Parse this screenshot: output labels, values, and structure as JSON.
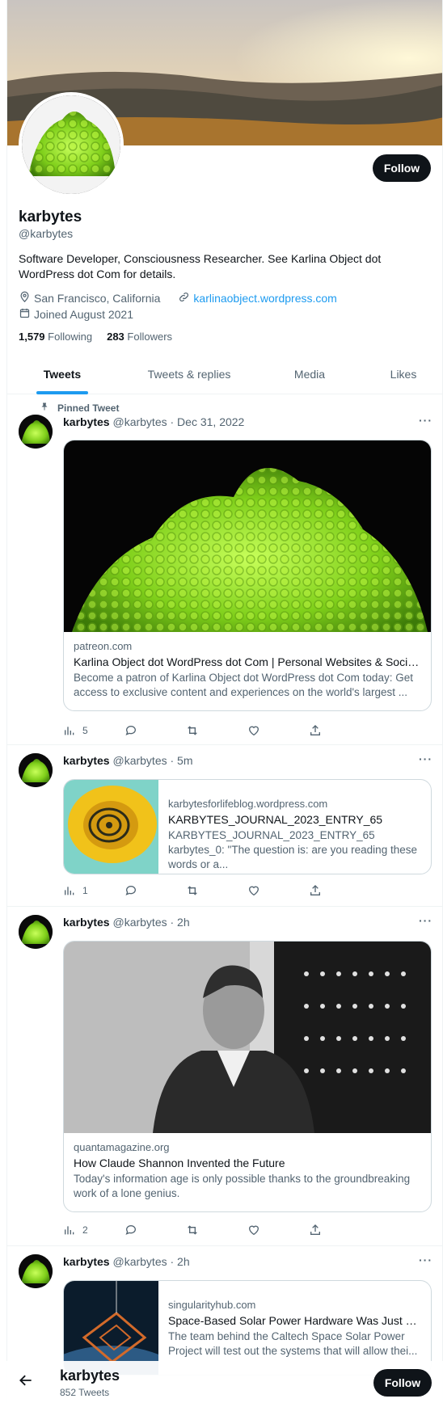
{
  "profile": {
    "name": "karbytes",
    "handle": "@karbytes",
    "follow_label": "Follow",
    "bio": "Software Developer, Consciousness Researcher. See Karlina Object dot WordPress dot Com for details.",
    "location": "San Francisco, California",
    "website": "karlinaobject.wordpress.com",
    "joined": "Joined August 2021",
    "following_count": "1,579",
    "following_label": "Following",
    "followers_count": "283",
    "followers_label": "Followers"
  },
  "tabs": [
    {
      "label": "Tweets"
    },
    {
      "label": "Tweets & replies"
    },
    {
      "label": "Media"
    },
    {
      "label": "Likes"
    }
  ],
  "pinned_label": "Pinned Tweet",
  "tweets": [
    {
      "name": "karbytes",
      "handle": "@karbytes",
      "time": "· Dec 31, 2022",
      "card_domain": "patreon.com",
      "card_title": "Karlina Object dot WordPress dot Com | Personal Websites & Social M...",
      "card_desc": "Become a patron of Karlina Object dot WordPress dot Com today: Get access to exclusive content and experiences on the world's largest ...",
      "views": "5"
    },
    {
      "name": "karbytes",
      "handle": "@karbytes",
      "time": "· 5m",
      "card_domain": "karbytesforlifeblog.wordpress.com",
      "card_title": "KARBYTES_JOURNAL_2023_ENTRY_65",
      "card_desc": "KARBYTES_JOURNAL_2023_ENTRY_65 karbytes_0: \"The question is: are you reading these words or a...",
      "views": "1"
    },
    {
      "name": "karbytes",
      "handle": "@karbytes",
      "time": "· 2h",
      "card_domain": "quantamagazine.org",
      "card_title": "How Claude Shannon Invented the Future",
      "card_desc": "Today's information age is only possible thanks to the groundbreaking work of a lone genius.",
      "views": "2"
    },
    {
      "name": "karbytes",
      "handle": "@karbytes",
      "time": "· 2h",
      "card_domain": "singularityhub.com",
      "card_title": "Space-Based Solar Power Hardware Was Just Lau...",
      "card_desc": "The team behind the Caltech Space Solar Power Project will test out the systems that will allow thei...",
      "views": ""
    }
  ],
  "bottom_bar": {
    "name": "karbytes",
    "tweet_count": "852 Tweets",
    "follow_label": "Follow"
  },
  "colors": {
    "accent": "#1d9bf0",
    "button": "#0f1419",
    "muted": "#536471",
    "border": "#cfd9de"
  }
}
